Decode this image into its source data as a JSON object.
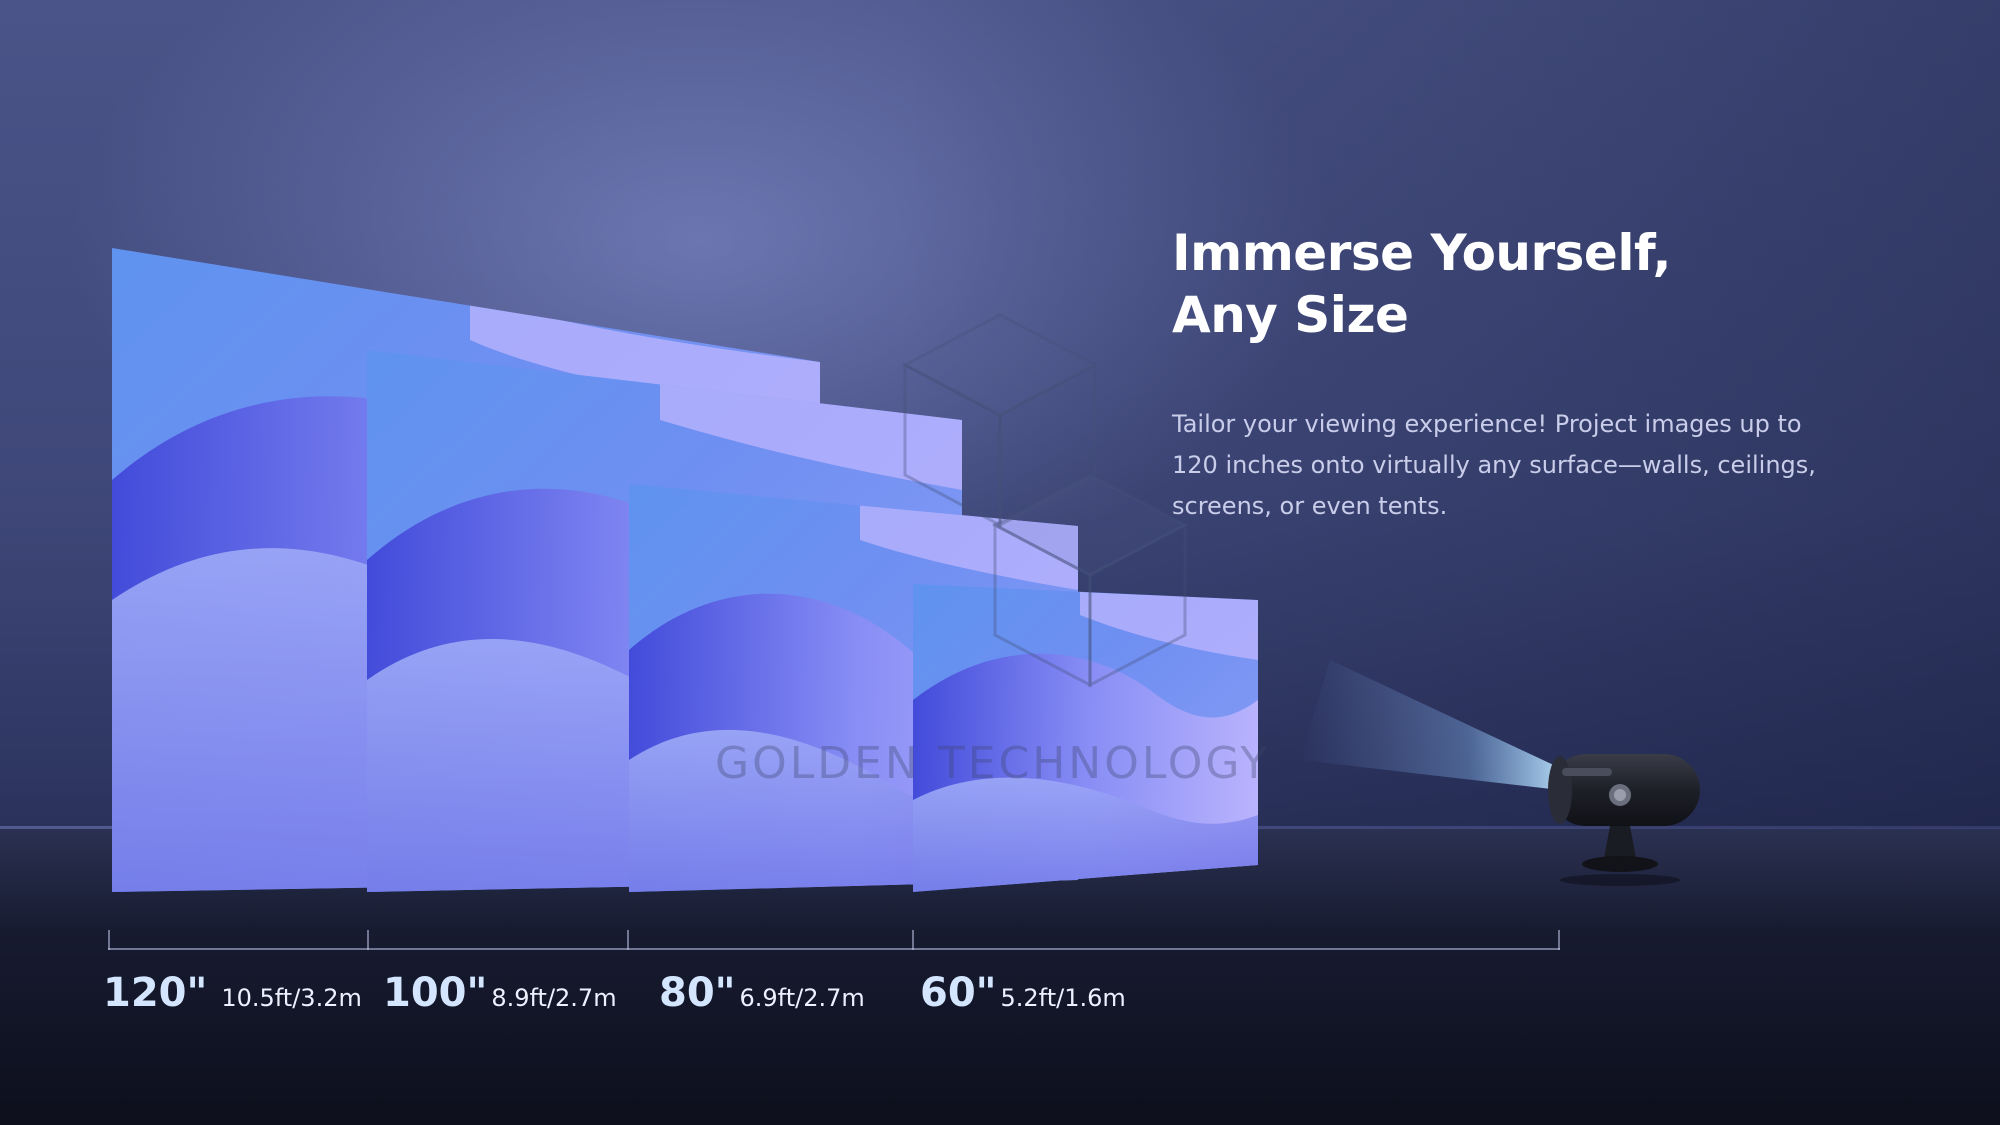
{
  "headline": {
    "line1": "Immerse Yourself,",
    "line2": "Any Size"
  },
  "description": "Tailor your viewing experience! Project images up to 120 inches onto virtually any surface—walls, ceilings, screens, or even tents.",
  "sizes": [
    {
      "size": "120\"",
      "distance": "10.5ft/3.2m"
    },
    {
      "size": "100\"",
      "distance": "8.9ft/2.7m"
    },
    {
      "size": "80\"",
      "distance": "6.9ft/2.7m"
    },
    {
      "size": "60\"",
      "distance": "5.2ft/1.6m"
    }
  ],
  "watermark": "GOLDEN TECHNOLOGY",
  "colors": {
    "screen_base": "#6f8ff2",
    "screen_highlight": "#c3b8ff",
    "screen_deep": "#3c3fd6",
    "beam": "#9fd6ff"
  },
  "icons": [
    "projector-icon",
    "watermark-cube-logo"
  ]
}
